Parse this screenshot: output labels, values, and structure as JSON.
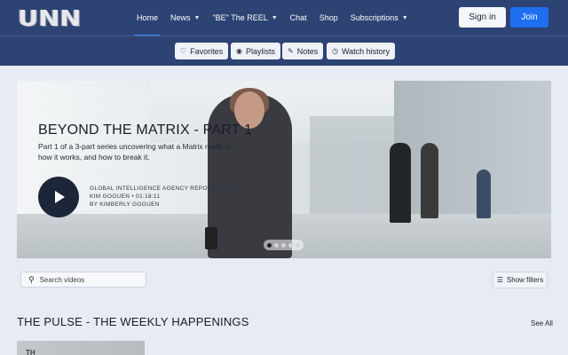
{
  "brand": {
    "logo_text": "UNN"
  },
  "nav": {
    "items": [
      {
        "label": "Home",
        "active": true,
        "has_menu": false
      },
      {
        "label": "News",
        "active": false,
        "has_menu": true
      },
      {
        "label": "\"BE\" The REEL",
        "active": false,
        "has_menu": true
      },
      {
        "label": "Chat",
        "active": false,
        "has_menu": false
      },
      {
        "label": "Shop",
        "active": false,
        "has_menu": false
      },
      {
        "label": "Subscriptions",
        "active": false,
        "has_menu": true
      }
    ],
    "signin_label": "Sign in",
    "join_label": "Join"
  },
  "library": {
    "favorites_label": "Favorites",
    "playlists_label": "Playlists",
    "notes_label": "Notes",
    "history_label": "Watch history"
  },
  "hero": {
    "title": "BEYOND THE MATRIX - PART 1",
    "description": "Part 1 of a 3-part series uncovering what a Matrix really is, how it works, and how to break it.",
    "meta_line1": "GLOBAL INTELLIGENCE AGENCY REPORTS WITH KIM GOGUEN • 01:18:11",
    "meta_line2": "BY KIMBERLY GOGUEN",
    "slides_total": 5,
    "slide_active": 1
  },
  "search": {
    "placeholder": "Search videos"
  },
  "filters": {
    "label": "Show filters"
  },
  "section": {
    "title": "THE PULSE - THE WEEKLY HAPPENINGS",
    "see_all_label": "See All",
    "first_thumb_text": "TH"
  },
  "colors": {
    "nav_bg": "#2d4374",
    "accent": "#1e6ff0",
    "page_bg": "#e7ebf3"
  },
  "icons": {
    "favorites": "heart-icon",
    "playlists": "playlist-icon",
    "notes": "edit-icon",
    "history": "clock-icon",
    "search": "search-icon",
    "filters": "filter-icon",
    "play": "play-icon",
    "menu": "chevron-down-icon"
  }
}
